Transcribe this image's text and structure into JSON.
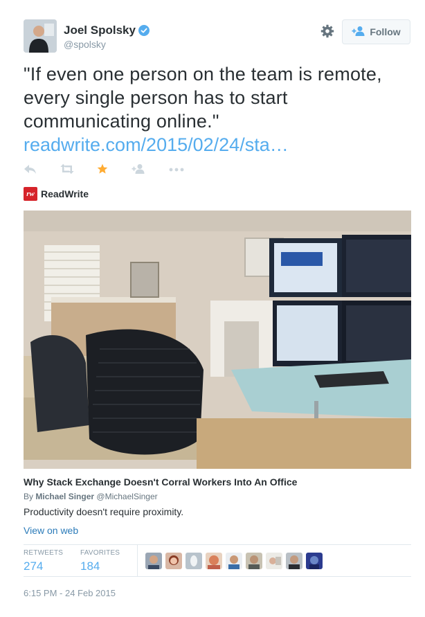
{
  "header": {
    "fullname": "Joel Spolsky",
    "handle": "@spolsky",
    "follow_label": "Follow",
    "icons": [
      "verified-badge-icon",
      "gear-icon",
      "follow-person-icon"
    ],
    "accent": "#55acee"
  },
  "tweet": {
    "text": "\"If even one person on the team is remote, every single person has to start communicating online.\"",
    "link": "readwrite.com/2015/02/24/sta…"
  },
  "actions": [
    "reply-icon",
    "retweet-icon",
    "favorite-star-icon",
    "follow-icon",
    "more-icon"
  ],
  "card": {
    "source_name": "ReadWrite",
    "source_logo": "rw",
    "title": "Why Stack Exchange Doesn't Corral Workers Into An Office",
    "byline_prefix": "By",
    "author": "Michael Singer",
    "author_handle": "@MichaelSinger",
    "description": "Productivity doesn't require proximity.",
    "view_label": "View on web"
  },
  "stats": {
    "retweets_label": "RETWEETS",
    "retweets_count": "274",
    "favorites_label": "FAVORITES",
    "favorites_count": "184"
  },
  "timestamp": "6:15 PM - 24 Feb 2015",
  "colors": {
    "text": "#292f33",
    "muted": "#8899a6",
    "link": "#55acee",
    "star": "#ffac33",
    "brand_red": "#d6232a"
  }
}
